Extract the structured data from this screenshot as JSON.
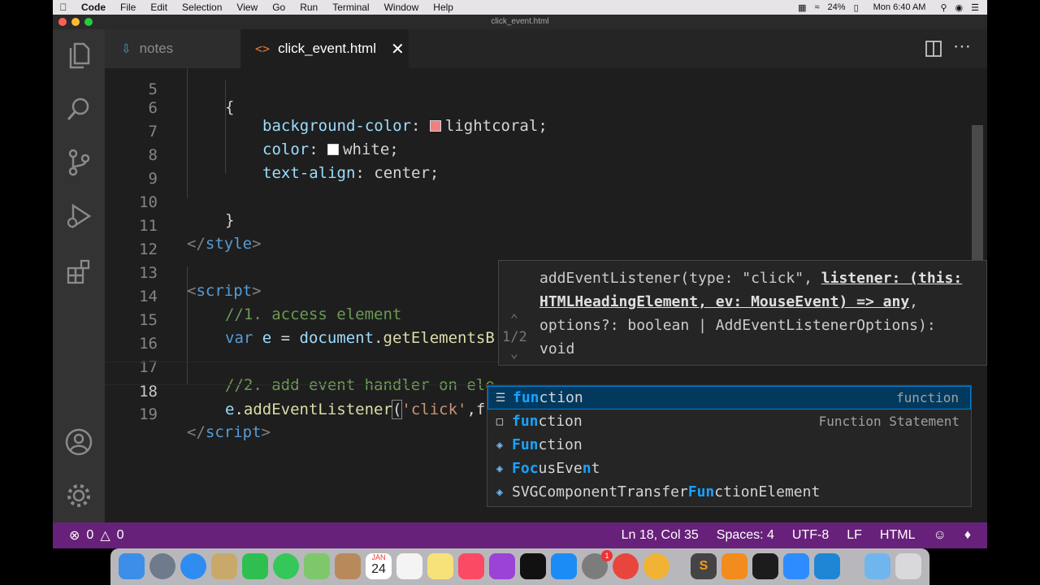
{
  "menubar": {
    "app": "Code",
    "items": [
      "File",
      "Edit",
      "Selection",
      "View",
      "Go",
      "Run",
      "Terminal",
      "Window",
      "Help"
    ],
    "battery": "24%",
    "clock": "Mon 6:40 AM"
  },
  "window": {
    "title": "click_event.html"
  },
  "tabs": [
    {
      "label": "notes"
    },
    {
      "label": "click_event.html"
    }
  ],
  "editor": {
    "partial_line_number": "5",
    "partial_line_code": "{",
    "line_numbers": [
      "6",
      "7",
      "8",
      "9",
      "10",
      "11",
      "12",
      "13",
      "14",
      "15",
      "16",
      "17",
      "18",
      "19"
    ],
    "lines": {
      "l6": {
        "prop": "background-color",
        "colon": ": ",
        "value": "lightcoral",
        "end": ";"
      },
      "l7": {
        "prop": "color",
        "colon": ": ",
        "value": "white",
        "end": ";"
      },
      "l8": {
        "prop": "text-align",
        "colon": ": ",
        "value": "center",
        "end": ";"
      },
      "l10": {
        "brace": "}"
      },
      "l11": {
        "open": "</",
        "tag": "style",
        "close": ">"
      },
      "l13": {
        "open": "<",
        "tag": "script",
        "close": ">"
      },
      "l14": {
        "comment": "//1. access element"
      },
      "l15": {
        "kw": "var",
        "var": " e",
        "eq": " = ",
        "obj": "document",
        "dot": ".",
        "fn": "getElementsB"
      },
      "l17": {
        "comment": "//2. add event handler on ele"
      },
      "l18": {
        "var": "e",
        "dot": ".",
        "fn": "addEventListener",
        "p1": "(",
        "str": "'click'",
        "comma": ",",
        "typed": "fun",
        "p2": ")"
      },
      "l19": {
        "open": "</",
        "tag": "script",
        "close": ">"
      }
    }
  },
  "signature_help": {
    "counter": "1/2",
    "pre": "addEventListener(type: \"click\", ",
    "active_param": "listener: (this: HTMLHeadingElement, ev: MouseEvent) => any",
    "post": ", options?: boolean | AddEventListenerOptions): void"
  },
  "suggestions": [
    {
      "hl": "fun",
      "rest": "ction",
      "detail": "function",
      "icon": "snippet-icon"
    },
    {
      "hl": "fun",
      "rest": "ction",
      "detail": "Function Statement",
      "icon": "keyword-icon"
    },
    {
      "hl": "Fun",
      "rest": "ction",
      "detail": "",
      "icon": "class-icon"
    },
    {
      "parts": [
        "Fo",
        "c",
        "u",
        "sEve",
        "n",
        "t"
      ],
      "detail": "",
      "icon": "class-icon"
    },
    {
      "pre": "SVGComponentTransfer",
      "hl": "Fun",
      "rest": "ctionElement",
      "detail": "",
      "icon": "class-icon"
    }
  ],
  "statusbar": {
    "errors": "0",
    "warnings": "0",
    "position": "Ln 18, Col 35",
    "spaces": "Spaces: 4",
    "encoding": "UTF-8",
    "eol": "LF",
    "language": "HTML"
  },
  "dock": {
    "calendar_month": "JAN",
    "calendar_day": "24",
    "badge": "1"
  },
  "colors": {
    "status_bar": "#68217a",
    "editor_bg": "#1e1e1e",
    "selection": "#04395e",
    "match_highlight": "#18a3ff",
    "lightcoral_swatch": "#f08080"
  }
}
